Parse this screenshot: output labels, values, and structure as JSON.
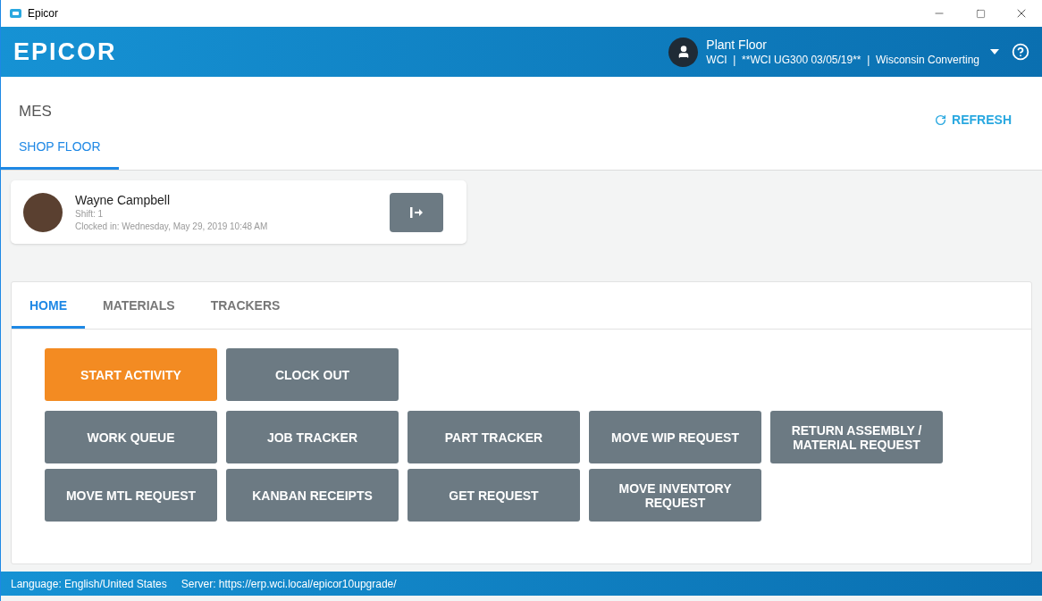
{
  "window": {
    "title": "Epicor"
  },
  "header": {
    "logo": "EPICOR",
    "user": {
      "title": "Plant Floor",
      "details": "WCI  |  **WCI UG300 03/05/19**  |  Wisconsin Converting"
    }
  },
  "page": {
    "title": "MES",
    "refresh": "REFRESH",
    "tabs": [
      {
        "label": "SHOP FLOOR",
        "selected": true
      }
    ]
  },
  "employee": {
    "name": "Wayne Campbell",
    "shift": "Shift: 1",
    "clocked_in": "Clocked in: Wednesday, May 29, 2019 10:48 AM"
  },
  "tabs": [
    {
      "label": "HOME",
      "selected": true
    },
    {
      "label": "MATERIALS",
      "selected": false
    },
    {
      "label": "TRACKERS",
      "selected": false
    }
  ],
  "button_rows": [
    [
      {
        "label": "START ACTIVITY",
        "kind": "primary"
      },
      {
        "label": "CLOCK OUT",
        "kind": "secondary"
      }
    ],
    [
      {
        "label": "WORK QUEUE",
        "kind": "secondary"
      },
      {
        "label": "JOB TRACKER",
        "kind": "secondary"
      },
      {
        "label": "PART TRACKER",
        "kind": "secondary"
      },
      {
        "label": "MOVE WIP REQUEST",
        "kind": "secondary"
      },
      {
        "label": "RETURN ASSEMBLY / MATERIAL REQUEST",
        "kind": "secondary"
      }
    ],
    [
      {
        "label": "MOVE MTL REQUEST",
        "kind": "secondary"
      },
      {
        "label": "KANBAN RECEIPTS",
        "kind": "secondary"
      },
      {
        "label": "GET REQUEST",
        "kind": "secondary"
      },
      {
        "label": "MOVE INVENTORY REQUEST",
        "kind": "secondary"
      }
    ]
  ],
  "status_bar": {
    "language": "Language: English/United States",
    "server": "Server: https://erp.wci.local/epicor10upgrade/"
  }
}
